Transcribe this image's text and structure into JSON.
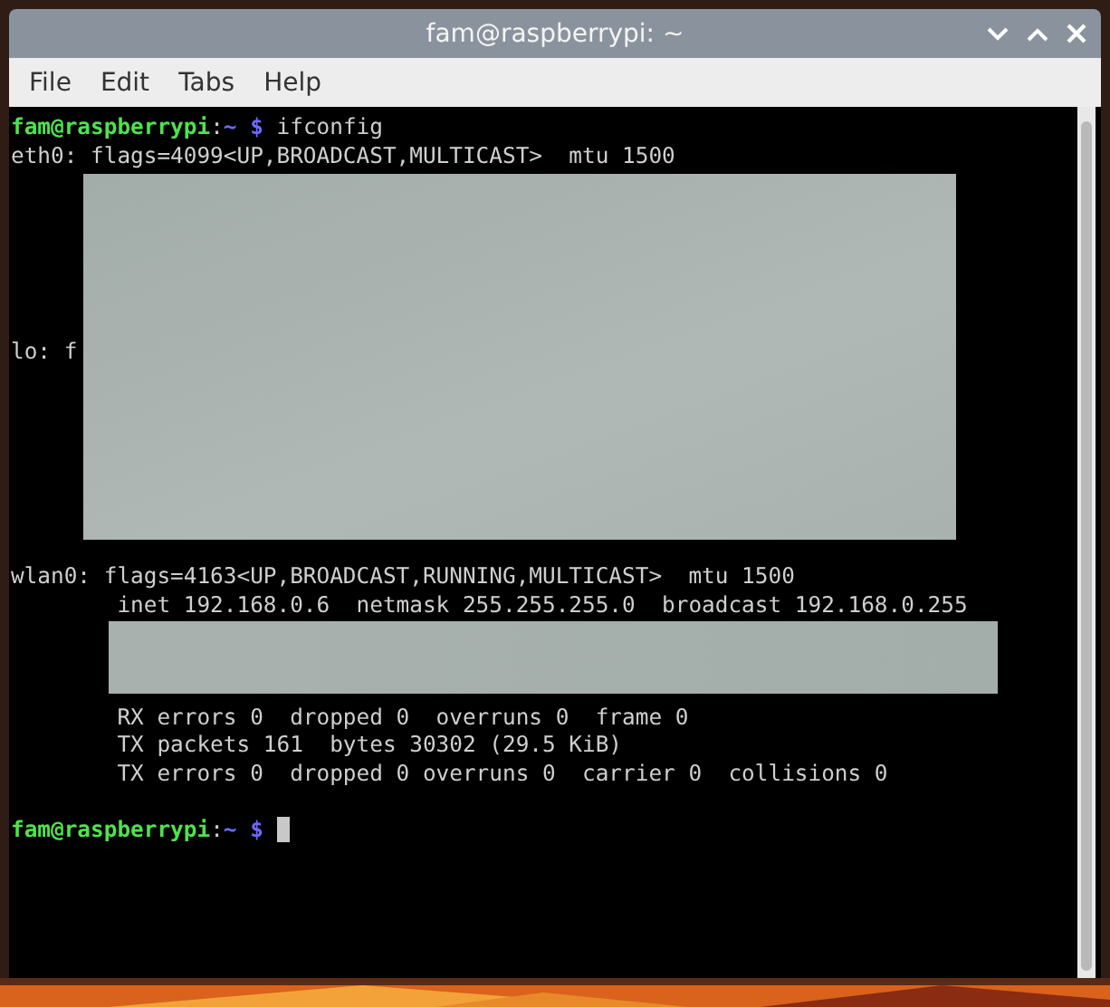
{
  "window": {
    "title": "fam@raspberrypi: ~"
  },
  "menu": [
    "File",
    "Edit",
    "Tabs",
    "Help"
  ],
  "terminal": {
    "lines": [
      {
        "kind": "prompt",
        "user": "fam@raspberrypi",
        "sep": ":",
        "path": "~",
        "sigil": "$",
        "command": "ifconfig",
        "cursor": false
      },
      {
        "kind": "output",
        "text": "eth0: flags=4099<UP,BROADCAST,MULTICAST>  mtu 1500"
      },
      {
        "kind": "blank"
      },
      {
        "kind": "blank"
      },
      {
        "kind": "blank"
      },
      {
        "kind": "blank"
      },
      {
        "kind": "blank"
      },
      {
        "kind": "blank"
      },
      {
        "kind": "output",
        "text": "lo: f"
      },
      {
        "kind": "blank"
      },
      {
        "kind": "blank"
      },
      {
        "kind": "blank"
      },
      {
        "kind": "blank"
      },
      {
        "kind": "blank"
      },
      {
        "kind": "blank"
      },
      {
        "kind": "blank"
      },
      {
        "kind": "output",
        "text": "wlan0: flags=4163<UP,BROADCAST,RUNNING,MULTICAST>  mtu 1500"
      },
      {
        "kind": "output",
        "text": "        inet 192.168.0.6  netmask 255.255.255.0  broadcast 192.168.0.255"
      },
      {
        "kind": "blank"
      },
      {
        "kind": "blank"
      },
      {
        "kind": "blank"
      },
      {
        "kind": "output",
        "text": "        RX errors 0  dropped 0  overruns 0  frame 0"
      },
      {
        "kind": "output",
        "text": "        TX packets 161  bytes 30302 (29.5 KiB)"
      },
      {
        "kind": "output",
        "text": "        TX errors 0  dropped 0 overruns 0  carrier 0  collisions 0"
      },
      {
        "kind": "blank"
      },
      {
        "kind": "prompt",
        "user": "fam@raspberrypi",
        "sep": ":",
        "path": "~",
        "sigil": "$",
        "cursor": true
      }
    ]
  }
}
